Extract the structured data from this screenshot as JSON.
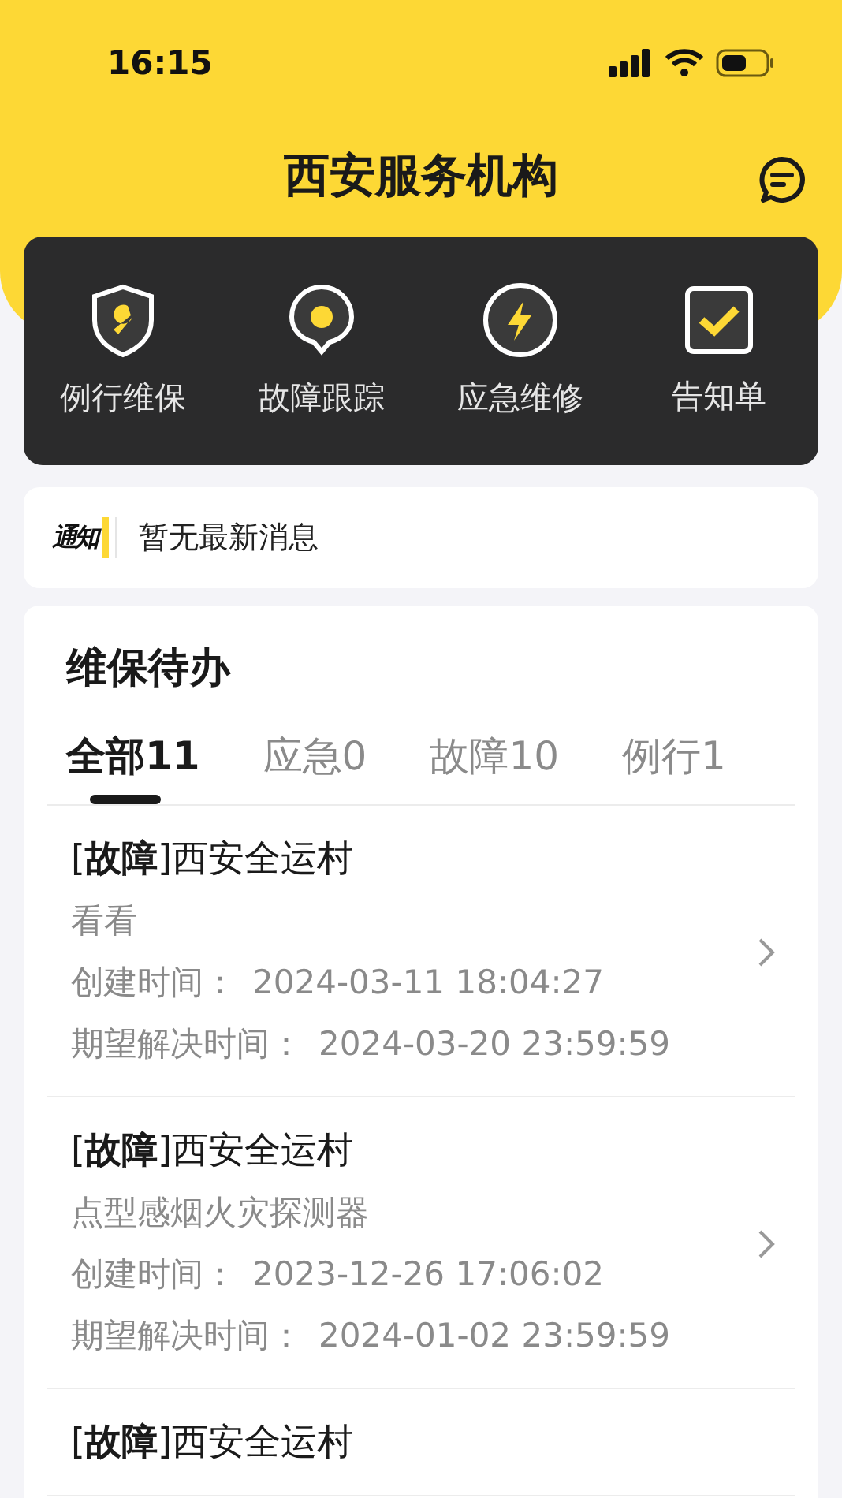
{
  "status_bar": {
    "time": "16:15"
  },
  "header": {
    "title": "西安服务机构"
  },
  "quick_actions": [
    {
      "kind": "shield",
      "label": "例行维保"
    },
    {
      "kind": "pin",
      "label": "故障跟踪"
    },
    {
      "kind": "bolt",
      "label": "应急维修"
    },
    {
      "kind": "check",
      "label": "告知单"
    }
  ],
  "notice": {
    "badge": "通知",
    "text": "暂无最新消息"
  },
  "todo": {
    "title": "维保待办",
    "tabs": [
      {
        "label": "全部11",
        "selected": true
      },
      {
        "label": "应急0",
        "selected": false
      },
      {
        "label": "故障10",
        "selected": false
      },
      {
        "label": "例行1",
        "selected": false
      }
    ],
    "items": [
      {
        "title": "[**故障**]西安全运村",
        "description": "看看",
        "created_label": "创建时间：",
        "created": "2024-03-11 18:04:27",
        "due_label": "期望解决时间：",
        "due": "2024-03-20 23:59:59"
      },
      {
        "title": "[**故障**]西安全运村",
        "description": "点型感烟火灾探测器",
        "created_label": "创建时间：",
        "created": "2023-12-26 17:06:02",
        "due_label": "期望解决时间：",
        "due": "2024-01-02 23:59:59"
      },
      {
        "title": "[**故障**]西安全运村"
      }
    ]
  }
}
